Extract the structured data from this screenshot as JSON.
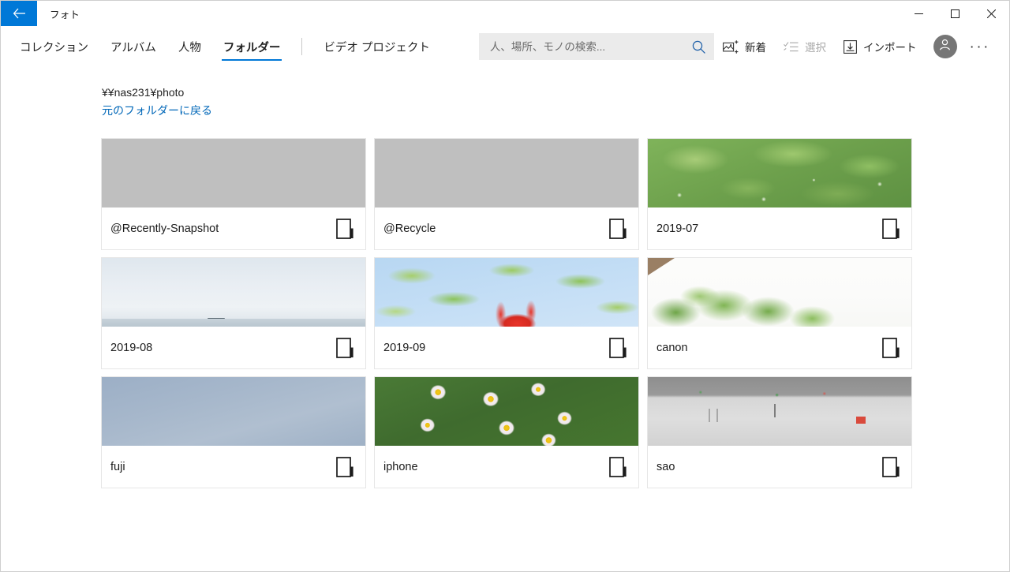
{
  "window": {
    "app_title": "フォト",
    "back_label": "戻る",
    "minimize_label": "最小化",
    "maximize_label": "最大化",
    "close_label": "閉じる"
  },
  "nav": {
    "tabs": [
      {
        "label": "コレクション",
        "active": false
      },
      {
        "label": "アルバム",
        "active": false
      },
      {
        "label": "人物",
        "active": false
      },
      {
        "label": "フォルダー",
        "active": true
      },
      {
        "label": "ビデオ プロジェクト",
        "active": false
      }
    ],
    "search": {
      "value": "",
      "placeholder": "人、場所、モノの検索...",
      "icon": "search-icon"
    },
    "tools": [
      {
        "label": "新着",
        "icon": "new-photos-icon",
        "disabled": false
      },
      {
        "label": "選択",
        "icon": "select-icon",
        "disabled": true
      },
      {
        "label": "インポート",
        "icon": "import-icon",
        "disabled": false
      }
    ],
    "account_icon": "person-avatar-icon",
    "more_label": "···"
  },
  "content": {
    "path": "¥¥nas231¥photo",
    "back_to_parent_link": "元のフォルダーに戻る",
    "folders": [
      {
        "name": "@Recently-Snapshot",
        "thumb": "placeholder",
        "icon": "folder-icon"
      },
      {
        "name": "@Recycle",
        "thumb": "placeholder",
        "icon": "folder-icon"
      },
      {
        "name": "2019-07",
        "thumb": "leaves",
        "icon": "folder-icon"
      },
      {
        "name": "2019-08",
        "thumb": "seasky",
        "icon": "folder-icon"
      },
      {
        "name": "2019-09",
        "thumb": "flower",
        "icon": "folder-icon"
      },
      {
        "name": "canon",
        "thumb": "trees",
        "icon": "folder-icon"
      },
      {
        "name": "fuji",
        "thumb": "sky",
        "icon": "folder-icon"
      },
      {
        "name": "iphone",
        "thumb": "daisies",
        "icon": "folder-icon"
      },
      {
        "name": "sao",
        "thumb": "snow",
        "icon": "folder-icon"
      }
    ]
  },
  "colors": {
    "accent": "#0078d7",
    "link": "#0067b8",
    "placeholder_thumb": "#bfbfbf",
    "search_bg": "#ebebeb",
    "card_border": "#e6e6e6",
    "disabled_text": "#a9a9a9"
  }
}
